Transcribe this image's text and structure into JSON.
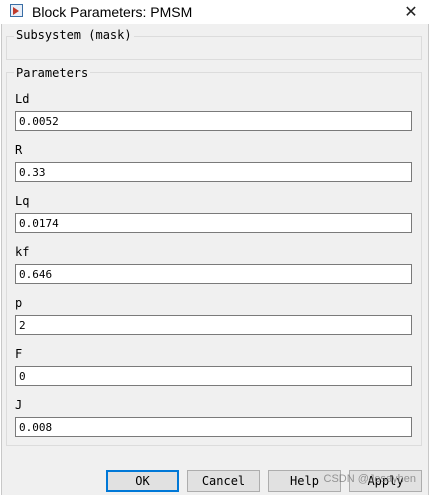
{
  "window": {
    "title": "Block Parameters: PMSM",
    "close_glyph": "✕"
  },
  "subsystem": {
    "label": "Subsystem (mask)"
  },
  "parameters": {
    "label": "Parameters",
    "fields": [
      {
        "label": "Ld",
        "value": "0.0052"
      },
      {
        "label": "R",
        "value": "0.33"
      },
      {
        "label": "Lq",
        "value": "0.0174"
      },
      {
        "label": "kf",
        "value": "0.646"
      },
      {
        "label": "p",
        "value": "2"
      },
      {
        "label": "F",
        "value": "0"
      },
      {
        "label": "J",
        "value": "0.008"
      }
    ]
  },
  "buttons": {
    "ok": "OK",
    "cancel": "Cancel",
    "help": "Help",
    "apply": "Apply"
  },
  "watermark": "CSDN @Jesayhen"
}
